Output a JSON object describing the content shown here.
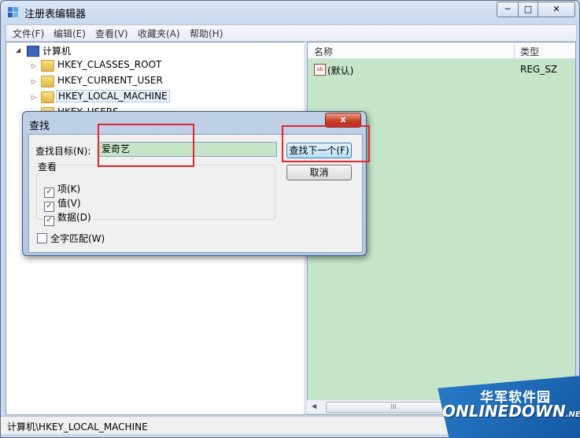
{
  "window": {
    "title": "注册表编辑器",
    "min_glyph": "─",
    "max_glyph": "□",
    "close_glyph": "✕"
  },
  "menu": [
    "文件(F)",
    "编辑(E)",
    "查看(V)",
    "收藏夹(A)",
    "帮助(H)"
  ],
  "tree": {
    "root": "计算机",
    "items": [
      "HKEY_CLASSES_ROOT",
      "HKEY_CURRENT_USER",
      "HKEY_LOCAL_MACHINE",
      "HKEY_USERS"
    ],
    "expander_glyph": "▷"
  },
  "list": {
    "headers": {
      "name": "名称",
      "type": "类型"
    },
    "rows": [
      {
        "name": "(默认)",
        "type": "REG_SZ",
        "icon_text": "ab"
      }
    ]
  },
  "hscroll": {
    "left_glyph": "◀",
    "right_glyph": "▶",
    "thumb_glyph": "III"
  },
  "status": "计算机\\HKEY_LOCAL_MACHINE",
  "dialog": {
    "title": "查找",
    "close_glyph": "x",
    "find_label": "查找目标(N):",
    "find_value": "爱奇艺",
    "find_next": "查找下一个(F)",
    "cancel": "取消",
    "look_at": "查看",
    "checks": [
      {
        "label": "项(K)",
        "checked": true
      },
      {
        "label": "值(V)",
        "checked": true
      },
      {
        "label": "数据(D)",
        "checked": true
      }
    ],
    "whole_word": {
      "label": "全字匹配(W)",
      "checked": false
    },
    "check_glyph": "✓"
  },
  "watermark": {
    "cn": "华军软件园",
    "en": "ONLINEDOWN",
    "net": ".NET"
  }
}
